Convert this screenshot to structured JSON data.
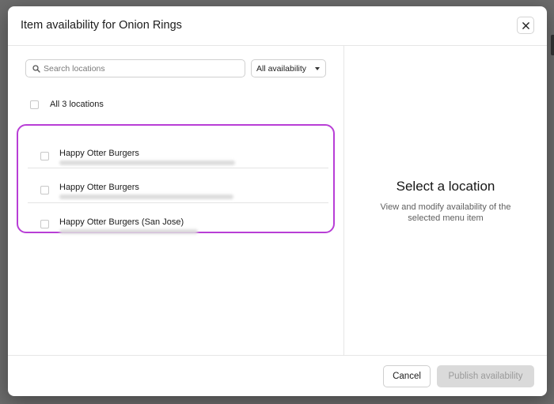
{
  "modal": {
    "title": "Item availability for Onion Rings"
  },
  "search": {
    "placeholder": "Search locations",
    "value": ""
  },
  "filter": {
    "selected": "All availability"
  },
  "locations": {
    "all_label": "All 3 locations",
    "items": [
      {
        "name": "Happy Otter Burgers"
      },
      {
        "name": "Happy Otter Burgers"
      },
      {
        "name": "Happy Otter Burgers (San Jose)"
      }
    ]
  },
  "detail": {
    "empty_title": "Select a location",
    "empty_description": "View and modify availability of the selected menu item"
  },
  "footer": {
    "cancel_label": "Cancel",
    "publish_label": "Publish availability"
  },
  "colors": {
    "highlight": "#b83ed6",
    "disabled_button": "#dadada"
  },
  "icons": {
    "search": "search-icon",
    "close": "close-icon",
    "dropdown": "chevron-down-icon"
  }
}
